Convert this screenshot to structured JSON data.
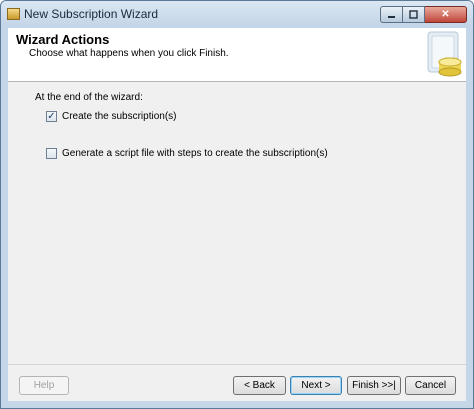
{
  "window": {
    "title": "New Subscription Wizard",
    "controls": {
      "minimize_icon": "minimize-icon",
      "maximize_icon": "maximize-icon",
      "close_icon": "close-icon",
      "close_glyph": "✕"
    }
  },
  "header": {
    "title": "Wizard Actions",
    "subtitle": "Choose what happens when you click Finish."
  },
  "body": {
    "group_label": "At the end of the wizard:",
    "options": [
      {
        "label": "Create the subscription(s)",
        "checked": true,
        "check_glyph": "✓"
      },
      {
        "label": "Generate a script file with steps to create the subscription(s)",
        "checked": false,
        "check_glyph": ""
      }
    ]
  },
  "footer": {
    "help_label": "Help",
    "back_label": "< Back",
    "next_label": "Next >",
    "finish_label": "Finish >>|",
    "cancel_label": "Cancel"
  },
  "colors": {
    "titlebar": "#c2d4e7",
    "close_button": "#c0463a",
    "panel": "#f0f0f0",
    "default_button_accent": "#3c7fb1"
  }
}
